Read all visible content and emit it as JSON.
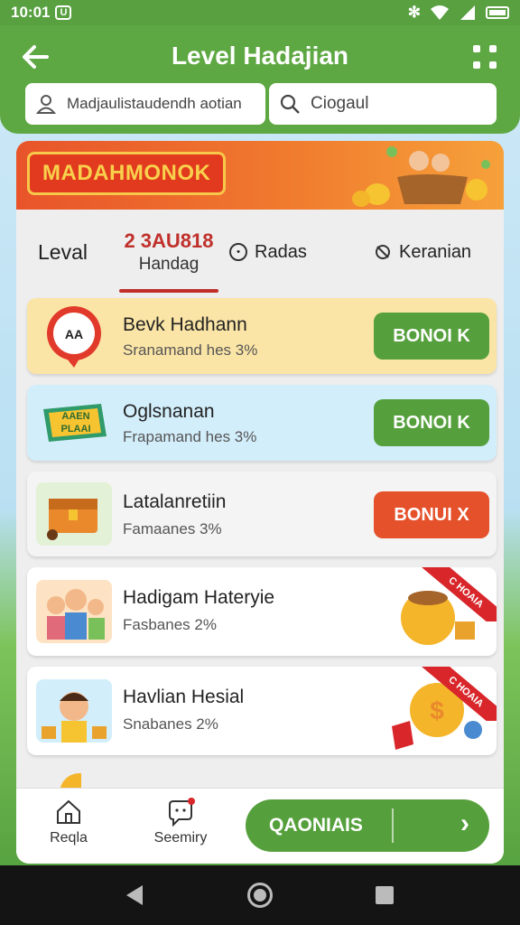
{
  "status_bar": {
    "time": "10:01",
    "badge": "U"
  },
  "header": {
    "title": "Level Hadajian",
    "search_left": "Madjaulistaudendh aotian",
    "search_right": "Ciogaul"
  },
  "banner": {
    "label": "MADAHMONOK"
  },
  "tabs": {
    "level": "Leval",
    "active_number": "2 3AU818",
    "active_label": "Handag",
    "radas": "Radas",
    "keranian": "Keranian"
  },
  "cards": [
    {
      "title": "Bevk Hadhann",
      "subtitle": "Sranamand hes 3%",
      "button": "BONOI K",
      "bg": "#fbe5a6",
      "button_color": "#55a03c",
      "icon_text": "AA"
    },
    {
      "title": "Oglsnanan",
      "subtitle": "Frapamand hes 3%",
      "button": "BONOI K",
      "bg": "#d3eefb",
      "button_color": "#55a03c",
      "icon_text": "AAEN PLAAI"
    },
    {
      "title": "Latalanretiin",
      "subtitle": "Famaanes 3%",
      "button": "BONUI X",
      "bg": "#f4f4f4",
      "button_color": "#e5512b"
    },
    {
      "title": "Hadigam Hateryie",
      "subtitle": "Fasbanes 2%",
      "bg": "#ffffff",
      "ribbon": "C HOAIA"
    },
    {
      "title": "Havlian Hesial",
      "subtitle": "Snabanes 2%",
      "bg": "#ffffff",
      "ribbon": "C HOAIA"
    }
  ],
  "bottom_nav": {
    "home": "Reqla",
    "seemiry": "Seemiry",
    "cta": "QAONIAIS"
  },
  "colors": {
    "brand_green": "#5ea843",
    "accent_red": "#c0302b",
    "orange": "#e5512b"
  }
}
